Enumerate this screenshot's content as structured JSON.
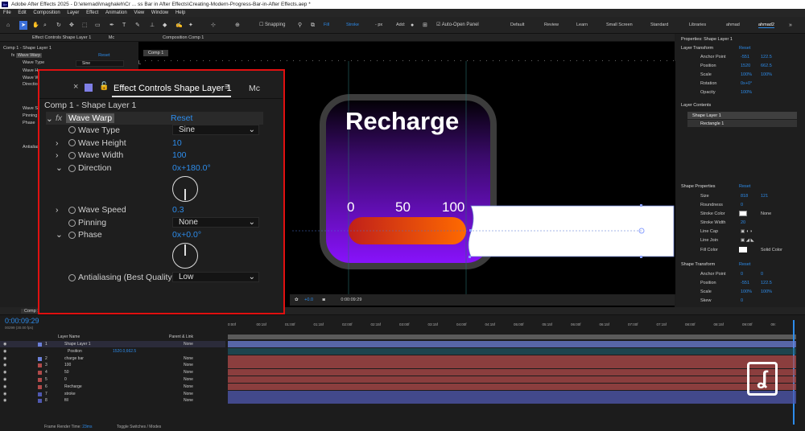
{
  "app": {
    "title": "Adobe After Effects 2025 - D:\\etemadi\\maghaleh\\Cr ... ss Bar in After Effects\\Creating-Modern-Progress-Bar-in-After Effects.aep *",
    "menu": [
      "File",
      "Edit",
      "Composition",
      "Layer",
      "Effect",
      "Animation",
      "View",
      "Window",
      "Help"
    ]
  },
  "toolbar": {
    "snapping": "Snapping",
    "fill": "Fill",
    "stroke": "Stroke",
    "stroke_px": "- px",
    "add": "Add:",
    "auto_open": "Auto-Open Panel",
    "workspaces": [
      "Default",
      "Review",
      "Learn",
      "Small Screen",
      "Standard",
      "Libraries",
      "ahmad",
      "ahmad2"
    ]
  },
  "left_panel": {
    "tab": "Effect Controls Shape Layer 1",
    "tab2": "Mc",
    "crumb": "Comp 1 - Shape Layer 1",
    "effect": "Wave Warp",
    "reset": "Reset",
    "props": [
      "Wave Type",
      "Wave H",
      "Wave W",
      "Direction",
      "Wave S",
      "Pinning",
      "Phase",
      "Antialiasi"
    ],
    "values": [
      "Sine",
      "",
      "",
      "",
      "",
      "",
      "",
      ""
    ]
  },
  "comp_panel": {
    "tab": "Composition Comp 1",
    "subtab": "Comp 1",
    "title_text": "Recharge",
    "ticks": [
      "0",
      "50",
      "100"
    ],
    "zoom": "+0.0",
    "time": "0:00:09:29"
  },
  "effect_controls": {
    "tab_label": "Effect Controls",
    "tab_layer": "Shape Layer 1",
    "tab2": "Mc",
    "crumb": "Comp 1 - Shape Layer 1",
    "fx_label": "fx",
    "effect_name": "Wave Warp",
    "reset": "Reset",
    "wave_type_label": "Wave Type",
    "wave_type_value": "Sine",
    "wave_height_label": "Wave Height",
    "wave_height_value": "10",
    "wave_width_label": "Wave Width",
    "wave_width_value": "100",
    "direction_label": "Direction",
    "direction_value": "0x+180.0°",
    "wave_speed_label": "Wave Speed",
    "wave_speed_value": "0.3",
    "pinning_label": "Pinning",
    "pinning_value": "None",
    "phase_label": "Phase",
    "phase_value": "0x+0.0°",
    "antialiasing_label": "Antialiasing (Best Quality",
    "antialiasing_value": "Low"
  },
  "right_panel": {
    "title": "Properties: Shape Layer 1",
    "layer_transform": "Layer Transform",
    "reset": "Reset",
    "anchor_label": "Anchor Point",
    "anchor_x": "-551",
    "anchor_y": "122.5",
    "position_label": "Position",
    "position_x": "1520",
    "position_y": "662.5",
    "scale_label": "Scale",
    "scale_x": "100%",
    "scale_y": "100%",
    "rotation_label": "Rotation",
    "rotation_value": "0x+0°",
    "opacity_label": "Opacity",
    "opacity_value": "100%",
    "layer_contents": "Layer Contents",
    "content_items": [
      "Shape Layer 1",
      "Rectangle 1"
    ],
    "shape_properties": "Shape Properties",
    "size_label": "Size",
    "size_w": "818",
    "size_h": "121",
    "roundness_label": "Roundness",
    "roundness_value": "0",
    "stroke_color_label": "Stroke Color",
    "stroke_color_value": "None",
    "stroke_width_label": "Stroke Width",
    "stroke_width_value": "20",
    "line_cap_label": "Line Cap",
    "line_join_label": "Line Join",
    "fill_color_label": "Fill Color",
    "fill_color_value": "Solid Color",
    "shape_transform": "Shape Transform",
    "st_anchor_label": "Anchor Point",
    "st_anchor_x": "0",
    "st_anchor_y": "0",
    "st_position_label": "Position",
    "st_position_x": "-551",
    "st_position_y": "122.5",
    "st_scale_label": "Scale",
    "st_scale_x": "100%",
    "st_scale_y": "100%",
    "st_skew_label": "Skew",
    "st_skew_value": "0"
  },
  "timeline": {
    "tab": "Comp 1",
    "timecode": "0:00:09:29",
    "fps": "00299 (30.00 fps)",
    "col_layer_name": "Layer Name",
    "col_parent": "Parent & Link",
    "ruler": [
      "0:00f",
      "00:15f",
      "01:00f",
      "01:15f",
      "02:00f",
      "02:15f",
      "03:00f",
      "03:15f",
      "04:00f",
      "04:15f",
      "05:00f",
      "05:15f",
      "06:00f",
      "06:15f",
      "07:00f",
      "07:15f",
      "08:00f",
      "08:15f",
      "09:00f",
      "09:"
    ],
    "layers": [
      {
        "num": "1",
        "name": "Shape Layer 1",
        "parent": "None"
      },
      {
        "num": "",
        "name": "Position",
        "parent": "1520.0,662.5"
      },
      {
        "num": "2",
        "name": "charge bar",
        "parent": "None"
      },
      {
        "num": "3",
        "name": "100",
        "parent": "None"
      },
      {
        "num": "4",
        "name": "50",
        "parent": "None"
      },
      {
        "num": "5",
        "name": "0",
        "parent": "None"
      },
      {
        "num": "6",
        "name": "Recharge",
        "parent": "None"
      },
      {
        "num": "7",
        "name": "stroke",
        "parent": "None"
      },
      {
        "num": "8",
        "name": "fill",
        "parent": "None"
      }
    ],
    "footer_render": "Frame Render Time:",
    "footer_render_value": "23ms",
    "footer_toggle": "Toggle Switches / Modes"
  },
  "colors": {
    "highlight_border": "#e01010",
    "accent_blue": "#2d8ceb",
    "purple": "#7a00e6",
    "bar_orange": "#ff6a00",
    "bar_red": "#c0201a"
  },
  "icons": [
    "adobe-ae-logo",
    "home-icon",
    "selection-tool-icon",
    "hand-tool-icon",
    "zoom-tool-icon",
    "pen-tool-icon",
    "text-tool-icon",
    "brush-tool-icon",
    "lock-icon",
    "stopwatch-icon",
    "chevron-down-icon",
    "angle-dial-icon",
    "watermark-logo"
  ]
}
